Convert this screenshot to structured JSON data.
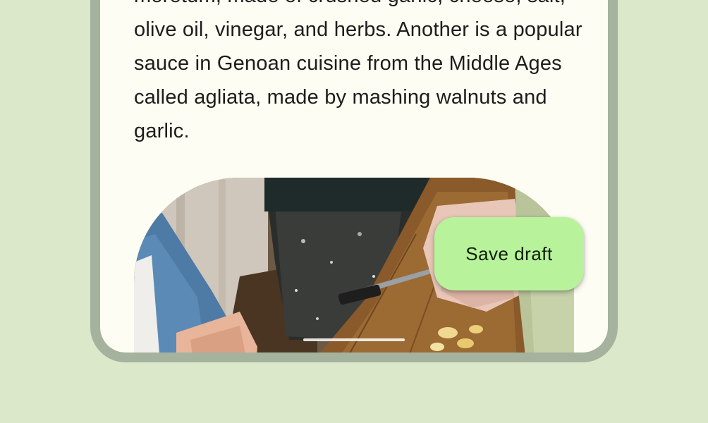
{
  "article": {
    "paragraph": "moretum, made of crushed garlic, cheese, salt, olive oil, vinegar, and herbs. Another is a popular sauce in Genoan cuisine from the Middle Ages called agliata, made by mashing walnuts and garlic."
  },
  "fab": {
    "label": "Save draft"
  },
  "colors": {
    "background": "#dbe8c9",
    "frame": "#a4b29e",
    "surface": "#fefdf4",
    "fab": "#b8f39c"
  }
}
